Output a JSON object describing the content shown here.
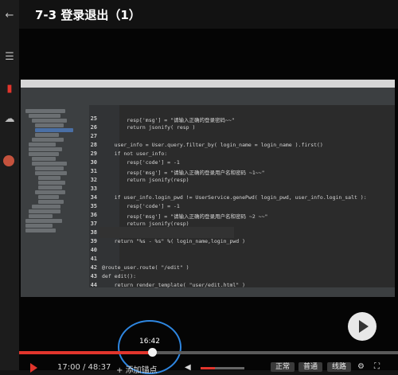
{
  "lesson_title": "7-3 登录退出（1）",
  "video": {
    "hover_time": "16:42",
    "time_display": "17:00 / 48:37",
    "progress": 0.35,
    "hover_position": 0.35,
    "add_point_label": "添加锚点",
    "quality_buttons": [
      "正常",
      "普通",
      "线路"
    ]
  },
  "editor": {
    "code_lines": [
      {
        "num": "25",
        "text": "        resp['msg'] = \"请输入正确的登录密码~~\""
      },
      {
        "num": "26",
        "text": "        return jsonify( resp )"
      },
      {
        "num": "27",
        "text": ""
      },
      {
        "num": "28",
        "text": "    user_info = User.query.filter_by( login_name = login_name ).first()"
      },
      {
        "num": "29",
        "text": "    if not user_info:"
      },
      {
        "num": "30",
        "text": "        resp['code'] = -1"
      },
      {
        "num": "31",
        "text": "        resp['msg'] = \"请输入正确的登录用户名和密码 ~1~~\""
      },
      {
        "num": "32",
        "text": "        return jsonify(resp)"
      },
      {
        "num": "33",
        "text": ""
      },
      {
        "num": "34",
        "text": "    if user_info.login_pwd != UserService.genePwd( login_pwd, user_info.login_salt ):"
      },
      {
        "num": "35",
        "text": "        resp['code'] = -1"
      },
      {
        "num": "36",
        "text": "        resp['msg'] = \"请输入正确的登录用户名和密码 ~2 ~~\""
      },
      {
        "num": "37",
        "text": "        return jsonify(resp)"
      },
      {
        "num": "38",
        "text": ""
      },
      {
        "num": "39",
        "text": "    return \"%s - %s\" %( login_name,login_pwd )"
      },
      {
        "num": "40",
        "text": ""
      },
      {
        "num": "41",
        "text": ""
      },
      {
        "num": "42",
        "text": "@route_user.route( \"/edit\" )"
      },
      {
        "num": "43",
        "text": "def edit():"
      },
      {
        "num": "44",
        "text": "    return render_template( \"user/edit.html\" )"
      }
    ]
  }
}
